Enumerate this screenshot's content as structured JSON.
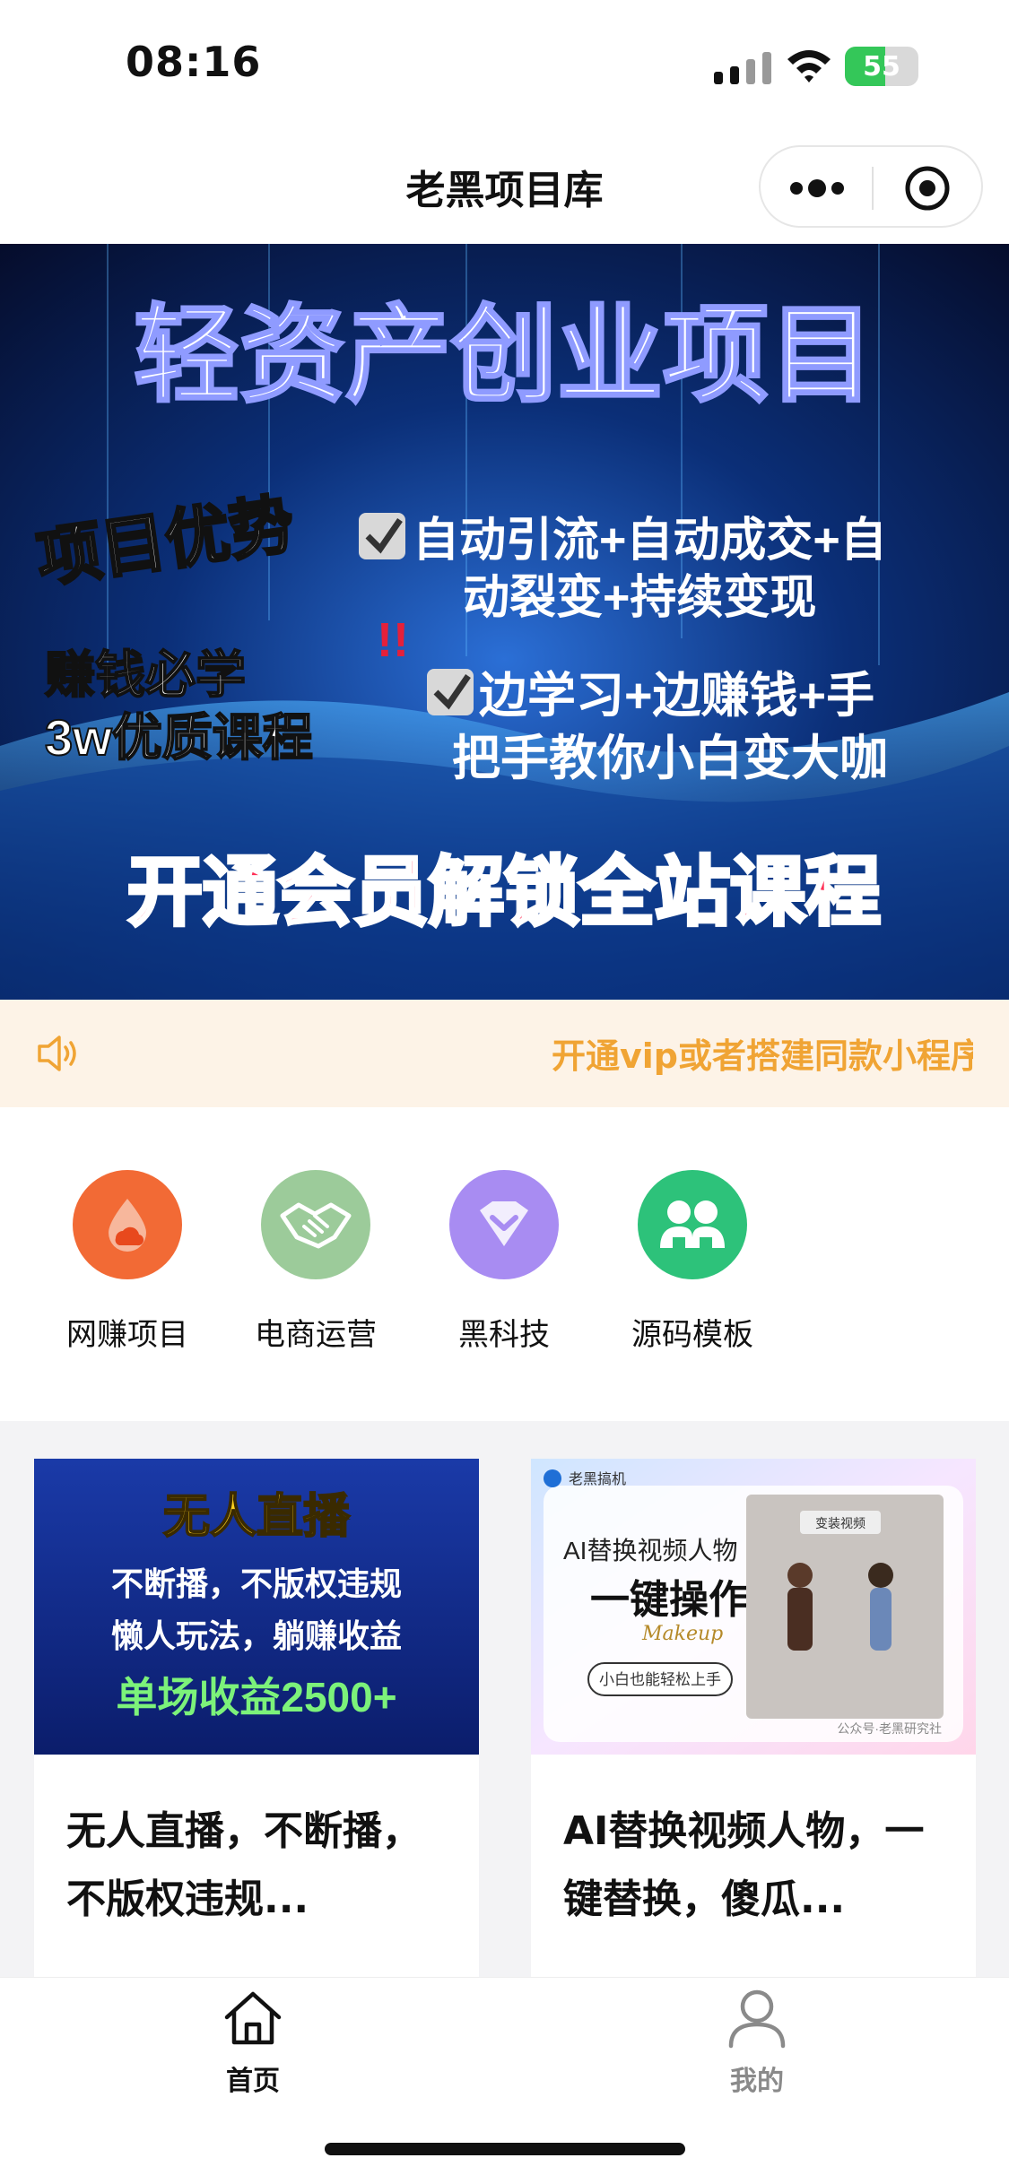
{
  "status_bar": {
    "time": "08:16",
    "battery": "55"
  },
  "nav": {
    "title": "老黑项目库",
    "more_icon": "more-dots-icon",
    "close_icon": "target-close-icon"
  },
  "banner": {
    "title": "轻资产创业项目",
    "badge_advantage": "项目优势",
    "bullet1_line1": "自动引流+自动成交+自",
    "bullet1_line2": "动裂变+持续变现",
    "badge_learn_line1": "赚钱必学",
    "badge_learn_line2": "3w优质课程",
    "bullet2_line1": "边学习+边赚钱+手",
    "bullet2_line2": "把手教你小白变大咖",
    "cta": "开通会员解锁全站课程",
    "exclaim": "!!"
  },
  "notice": {
    "text": "开通vip或者搭建同款小程序",
    "icon": "speaker-icon"
  },
  "categories": [
    {
      "label": "网赚项目",
      "icon": "drop-cloud-icon",
      "color": "#f26a35"
    },
    {
      "label": "电商运营",
      "icon": "handshake-icon",
      "color": "#9ccb9a"
    },
    {
      "label": "黑科技",
      "icon": "diamond-icon",
      "color": "#a88cf2"
    },
    {
      "label": "源码模板",
      "icon": "users-icon",
      "color": "#2dc27a"
    }
  ],
  "cards": [
    {
      "title": "无人直播，不断播，不版权违规...",
      "thumb": {
        "line1": "无人直播",
        "line2": "不断播，不版权违规",
        "line3": "懒人玩法，躺赚收益",
        "line4": "单场收益2500+"
      }
    },
    {
      "title": "AI替换视频人物，一键替换，傻瓜...",
      "thumb": {
        "brand": "老黑搞机",
        "line1": "AI替换视频人物",
        "line2": "一键操作",
        "line3": "Makeup",
        "pill": "小白也能轻松上手",
        "video_label": "变装视频",
        "watermark": "公众号·老黑研究社"
      }
    }
  ],
  "tabs": [
    {
      "label": "首页",
      "icon": "home-icon",
      "active": true
    },
    {
      "label": "我的",
      "icon": "user-icon",
      "active": false
    }
  ],
  "colors": {
    "accent": "#f58a1f",
    "notice_bg": "#fdf3e7",
    "notice_text": "#f0a434"
  }
}
